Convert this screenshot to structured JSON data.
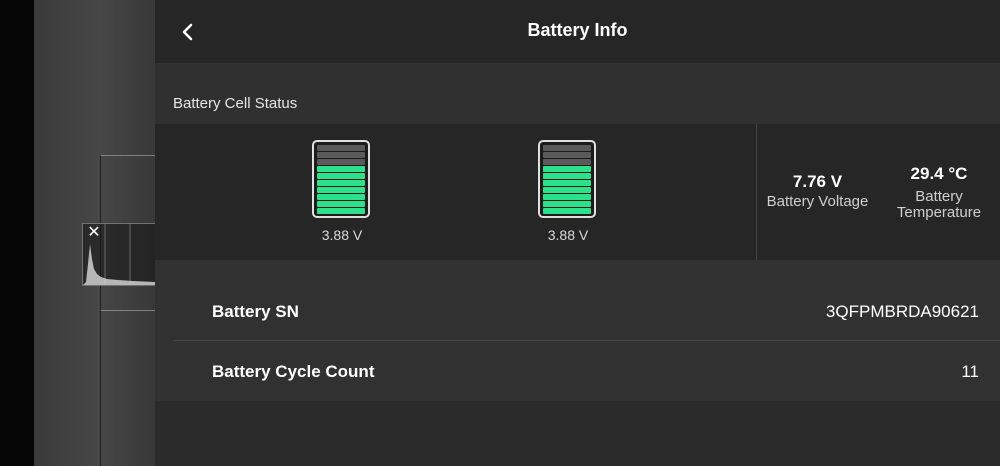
{
  "header": {
    "title": "Battery Info",
    "back_icon": "chevron-left-icon"
  },
  "histogram": {
    "close_icon": "close-icon"
  },
  "cell_status": {
    "label": "Battery Cell Status",
    "cells": [
      {
        "voltage": "3.88 V",
        "level": 0.7
      },
      {
        "voltage": "3.88 V",
        "level": 0.7
      }
    ],
    "fill_color": "#2ee08a",
    "empty_color": "#5a5a5a"
  },
  "voltage": {
    "value": "7.76 V",
    "label": "Battery Voltage"
  },
  "temperature": {
    "value": "29.4 °C",
    "label_line1": "Battery",
    "label_line2": "Temperature"
  },
  "info_rows": [
    {
      "key": "Battery SN",
      "value": "3QFPMBRDA90621"
    },
    {
      "key": "Battery Cycle Count",
      "value": "11"
    }
  ]
}
